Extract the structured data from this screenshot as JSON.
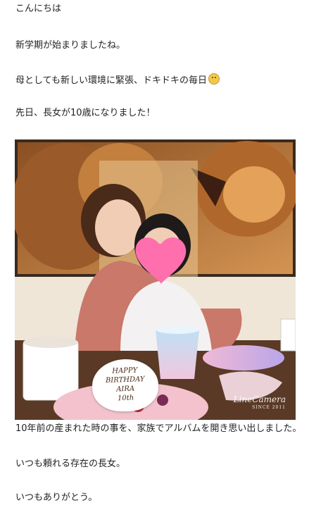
{
  "post": {
    "greeting": "こんにちは",
    "line1": "新学期が始まりましたね。",
    "line2": "母としても新しい環境に緊張、ドキドキの毎日",
    "line3": "先日、長女が10歳になりました！",
    "line4": "10年前の産まれた時の事を、家族でアルバムを開き思い出しました。",
    "line5": "いつも頼れる存在の長女。",
    "line6": "いつもありがとう。",
    "emoji_icon": "grinning-face-icon"
  },
  "photo": {
    "cake_card": {
      "line1": "HAPPY",
      "line2": "BIRTHDAY",
      "line3": "AIRA",
      "line4": "10th"
    },
    "watermark": {
      "brand": "LineCamera",
      "sub": "SINCE 2011"
    },
    "colors": {
      "heart": "#ff6fae",
      "sweater": "#c9786a",
      "cup": "#cfe3f2",
      "plate": "#e8b4d8"
    }
  }
}
